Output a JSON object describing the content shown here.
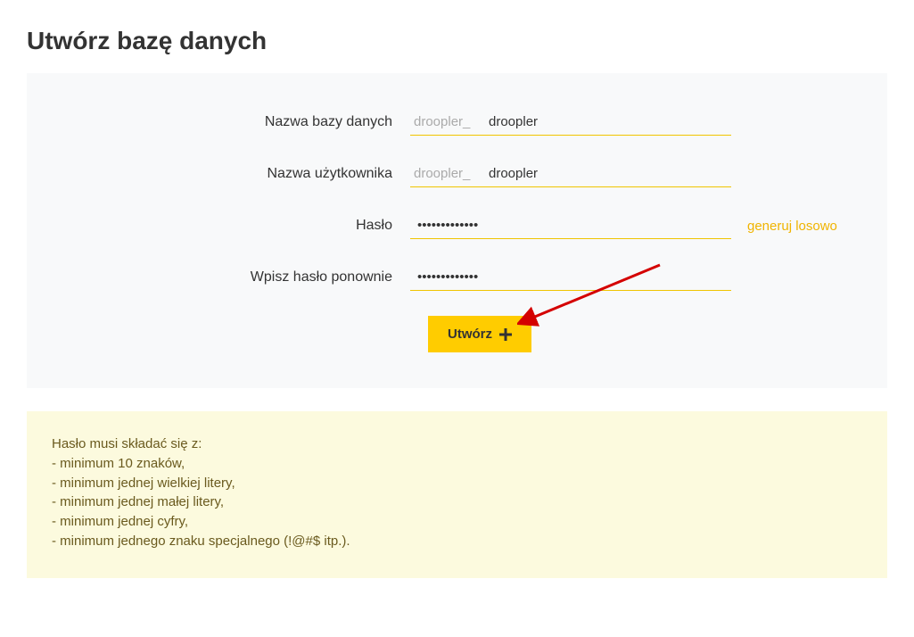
{
  "title": "Utwórz bazę danych",
  "form": {
    "dbname": {
      "label": "Nazwa bazy danych",
      "prefix": "droopler_",
      "value": "droopler"
    },
    "username": {
      "label": "Nazwa użytkownika",
      "prefix": "droopler_",
      "value": "droopler"
    },
    "password": {
      "label": "Hasło",
      "value": "•••••••••••••",
      "generate_link": "generuj losowo"
    },
    "password_confirm": {
      "label": "Wpisz hasło ponownie",
      "value": "•••••••••••••"
    },
    "submit_label": "Utwórz"
  },
  "hints": {
    "heading": "Hasło musi składać się z:",
    "items": [
      "- minimum 10 znaków,",
      "- minimum jednej wielkiej litery,",
      "- minimum jednej małej litery,",
      "- minimum jednej cyfry,",
      "- minimum jednego znaku specjalnego (!@#$ itp.)."
    ]
  }
}
